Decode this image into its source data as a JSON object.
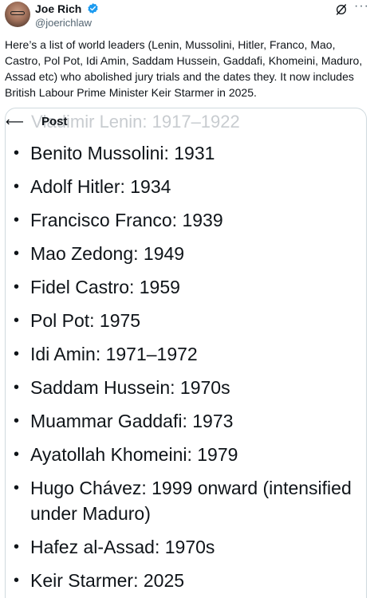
{
  "author": {
    "name": "Joe Rich",
    "handle": "@joerichlaw"
  },
  "icons": {
    "verified": "verified-badge-icon",
    "grok": "grok-icon",
    "more": "more-options-icon",
    "back": "back-arrow-icon",
    "avatar": "profile-photo"
  },
  "colors": {
    "verified": "#1d9bf0",
    "handle": "#536471",
    "text": "#0f1419",
    "border": "#cfd9de"
  },
  "tweet": {
    "text": "Here’s a list of world leaders (Lenin, Mussolini, Hitler, Franco, Mao, Castro, Pol Pot, Idi Amin, Saddam Hussein, Gaddafi, Khomeini, Maduro, Assad etc) who abolished jury trials and the dates they. It now includes British Labour Prime Minister Keir Starmer in 2025."
  },
  "card": {
    "faded_first": "Vladimir Lenin: 1917–1922",
    "overlay_label": "Post",
    "items": [
      {
        "text": "Benito Mussolini: 1931"
      },
      {
        "text": "Adolf Hitler: 1934"
      },
      {
        "text": "Francisco Franco: 1939"
      },
      {
        "text": "Mao Zedong: 1949"
      },
      {
        "text": "Fidel Castro: 1959"
      },
      {
        "text": "Pol Pot: 1975"
      },
      {
        "text": "Idi Amin: 1971–1972"
      },
      {
        "text": "Saddam Hussein: 1970s"
      },
      {
        "text": "Muammar Gaddafi: 1973"
      },
      {
        "text": "Ayatollah Khomeini: 1979"
      },
      {
        "text": "Hugo Chávez: 1999 onward (intensified under Maduro)"
      },
      {
        "text": "Hafez al-Assad: 1970s"
      },
      {
        "text": "Keir Starmer: 2025"
      }
    ]
  }
}
